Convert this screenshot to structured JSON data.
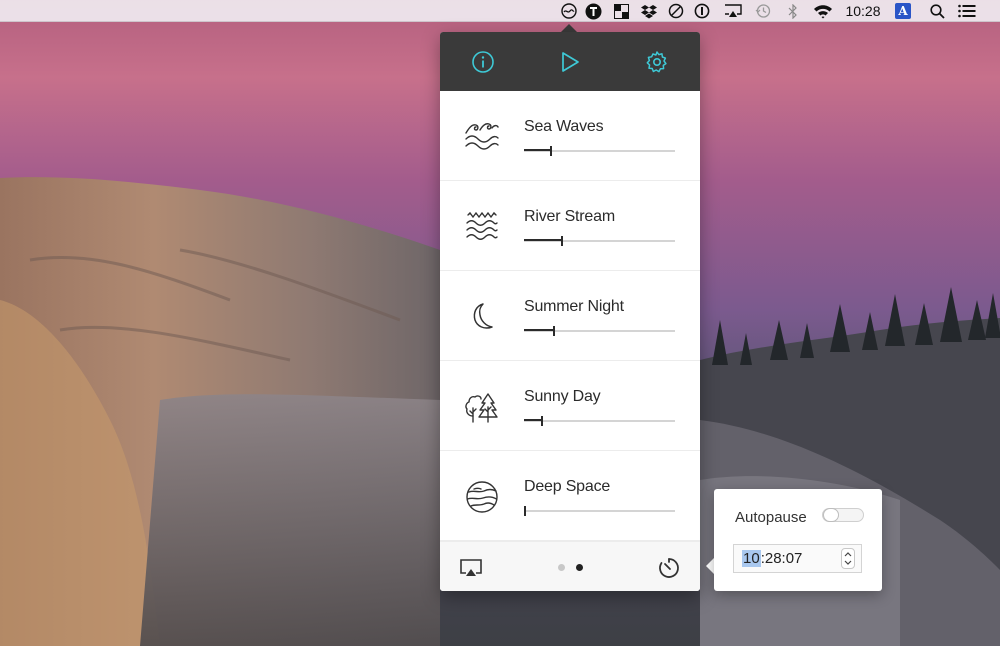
{
  "menubar": {
    "clock": "10:28",
    "badge_letter": "A",
    "icons": [
      "noizio-icon",
      "typeeto-icon",
      "checkerboard-icon",
      "dropbox-icon",
      "do-not-disturb-icon",
      "onepassword-icon",
      "airplay-icon",
      "time-machine-icon",
      "bluetooth-icon",
      "wifi-icon",
      "input-source-icon",
      "spotlight-icon",
      "notification-center-icon"
    ]
  },
  "header": {
    "buttons": [
      "info-icon",
      "play-icon",
      "settings-icon"
    ],
    "accent_color": "#3ec9d6"
  },
  "sounds": [
    {
      "name": "Sea Waves",
      "icon": "sea-waves-icon",
      "volume": 0.18
    },
    {
      "name": "River Stream",
      "icon": "river-stream-icon",
      "volume": 0.25
    },
    {
      "name": "Summer Night",
      "icon": "moon-icon",
      "volume": 0.2
    },
    {
      "name": "Sunny Day",
      "icon": "trees-icon",
      "volume": 0.12
    },
    {
      "name": "Deep Space",
      "icon": "planet-icon",
      "volume": 0.0
    }
  ],
  "footer": {
    "airplay_icon": "airplay-icon",
    "timer_icon": "timer-icon",
    "pages": 2,
    "active_page": 2
  },
  "autopause": {
    "label": "Autopause",
    "enabled": false,
    "time_hour": "10",
    "time_rest": ":28:07"
  }
}
